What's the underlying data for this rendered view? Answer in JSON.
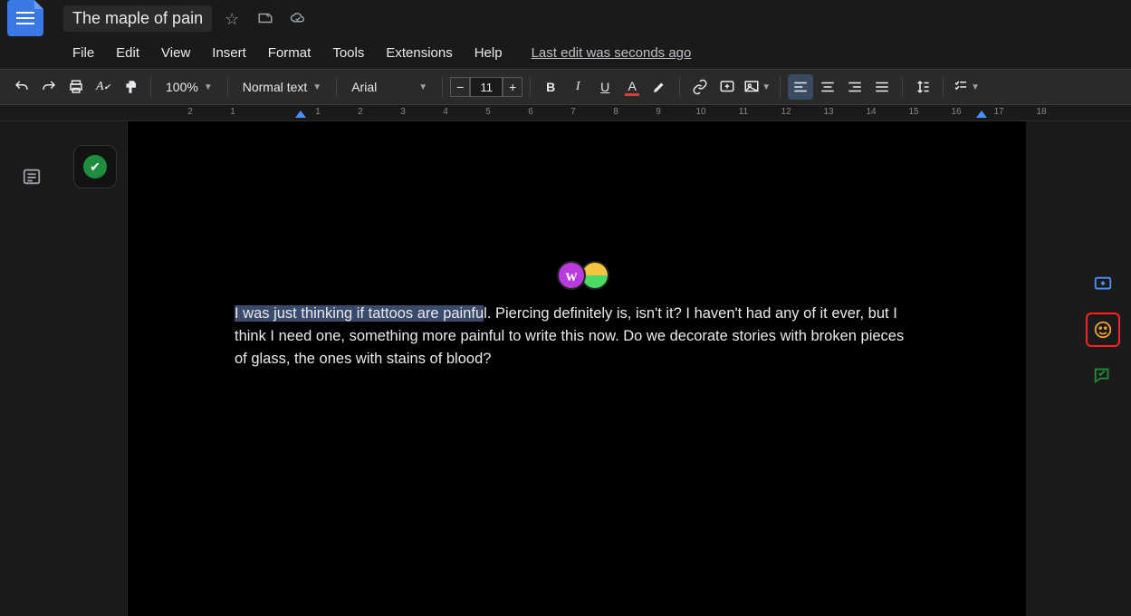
{
  "header": {
    "title": "The maple of pain",
    "last_edit": "Last edit was seconds ago"
  },
  "menus": [
    "File",
    "Edit",
    "View",
    "Insert",
    "Format",
    "Tools",
    "Extensions",
    "Help"
  ],
  "toolbar": {
    "zoom": "100%",
    "style": "Normal text",
    "font": "Arial",
    "font_size": "11"
  },
  "ruler_numbers": [
    "2",
    "1",
    "",
    "1",
    "2",
    "3",
    "4",
    "5",
    "6",
    "7",
    "8",
    "9",
    "10",
    "11",
    "12",
    "13",
    "14",
    "15",
    "16",
    "17",
    "18"
  ],
  "document": {
    "highlighted": "I was just thinking if tattoos are painfu",
    "rest": "l. Piercing definitely is, isn't it? I haven't had any of it ever, but I think I need one, something more painful to write this now. Do we decorate stories with broken pieces of glass, the ones with stains of blood?"
  },
  "collaborator_initial": "w"
}
